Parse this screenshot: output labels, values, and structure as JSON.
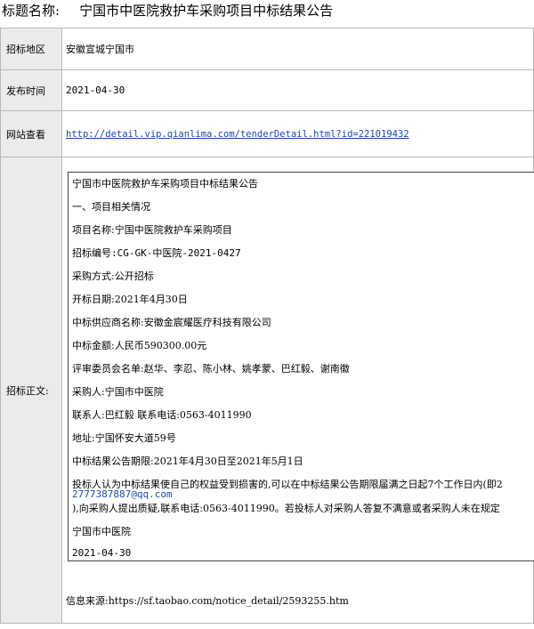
{
  "header": {
    "label": "标题名称:",
    "title": "宁国市中医院救护车采购项目中标结果公告"
  },
  "fields": {
    "region_label": "招标地区",
    "region_value": "安徽宣城宁国市",
    "date_label": "发布时间",
    "date_value": "2021-04-30",
    "url_label": "网站查看",
    "url_value": "http://detail.vip.qianlima.com/tenderDetail.html?id=221019432",
    "body_label": "招标正文:"
  },
  "notice": {
    "lines": [
      "宁国市中医院救护车采购项目中标结果公告",
      "一、项目相关情况",
      "项目名称:宁国中医院救护车采购项目",
      "招标编号:CG-GK-中医院-2021-0427",
      "采购方式:公开招标",
      "开标日期:2021年4月30日",
      "中标供应商名称:安徽金宸耀医疗科技有限公司",
      "中标金额:人民币590300.00元",
      "评审委员会名单:赵华、李忍、陈小林、姚孝蒙、巴红毅、谢南徽",
      "采购人:宁国市中医院",
      "联系人:巴红毅 联系电话:0563-4011990",
      "地址:宁国怀安大道59号",
      "中标结果公告期限:2021年4月30日至2021年5月1日"
    ],
    "para_line1": "投标人认为中标结果使自己的权益受到损害的,可以在中标结果公告期限届满之日起7个工作日内(即2",
    "para_email": "2777387887@qq.com",
    "para_line3": "),向采购人提出质疑,联系电话:0563-4011990。若投标人对采购人答复不满意或者采购人未在规定",
    "signer": "宁国市中医院",
    "sign_date": "2021-04-30"
  },
  "source": "信息来源:https://sf.taobao.com/notice_detail/2593255.htm"
}
